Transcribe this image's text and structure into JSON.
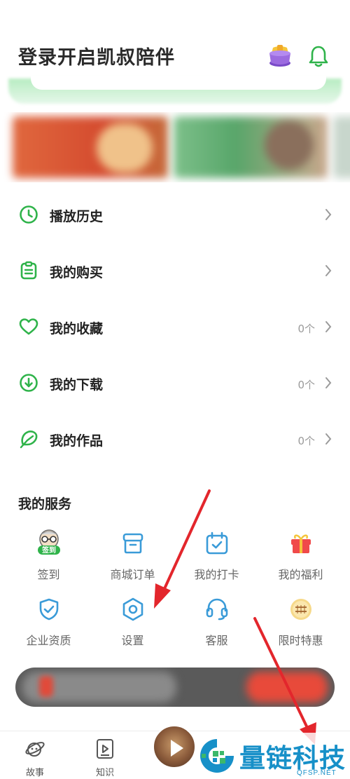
{
  "header": {
    "title": "登录开启凯叔陪伴",
    "icons": [
      "gift-box-icon",
      "bell-icon"
    ]
  },
  "colors": {
    "accent": "#2fb34a",
    "blue": "#3a9bd8",
    "red_arrow": "#e3262c",
    "watermark": "#1790c8"
  },
  "menu": {
    "items": [
      {
        "label": "播放历史",
        "icon": "clock-icon",
        "count": ""
      },
      {
        "label": "我的购买",
        "icon": "clipboard-icon",
        "count": ""
      },
      {
        "label": "我的收藏",
        "icon": "heart-icon",
        "count": "0个"
      },
      {
        "label": "我的下载",
        "icon": "download-icon",
        "count": "0个"
      },
      {
        "label": "我的作品",
        "icon": "leaf-icon",
        "count": "0个"
      }
    ]
  },
  "services": {
    "title": "我的服务",
    "items": [
      {
        "label": "签到",
        "icon": "check-in-avatar-icon",
        "badge": "签到"
      },
      {
        "label": "商城订单",
        "icon": "order-box-icon"
      },
      {
        "label": "我的打卡",
        "icon": "calendar-check-icon"
      },
      {
        "label": "我的福利",
        "icon": "gift-icon"
      },
      {
        "label": "企业资质",
        "icon": "shield-check-icon"
      },
      {
        "label": "设置",
        "icon": "settings-hexagon-icon"
      },
      {
        "label": "客服",
        "icon": "headset-icon"
      },
      {
        "label": "限时特惠",
        "icon": "promo-badge-icon"
      }
    ]
  },
  "tabbar": {
    "items": [
      {
        "label": "故事",
        "icon": "planet-icon"
      },
      {
        "label": "知识",
        "icon": "video-play-icon"
      }
    ]
  },
  "watermark": {
    "text": "量链科技",
    "sub": "QFSP.NET"
  }
}
